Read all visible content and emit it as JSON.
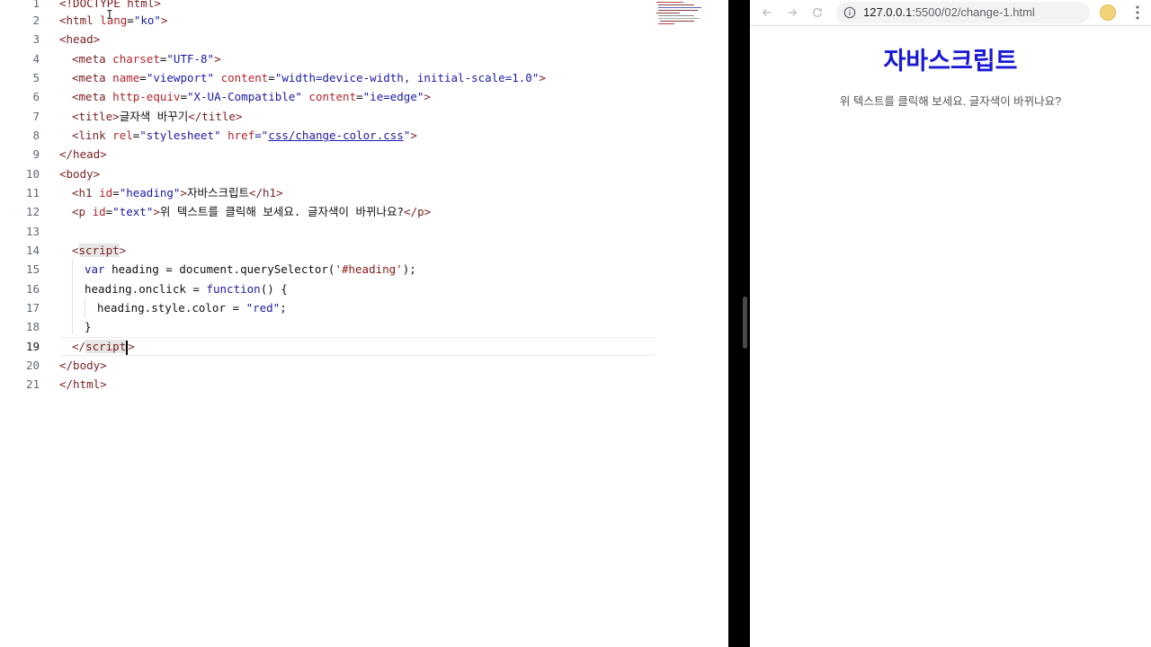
{
  "editor": {
    "active_line": 19,
    "line_numbers": [
      "1",
      "2",
      "3",
      "4",
      "5",
      "6",
      "7",
      "8",
      "9",
      "10",
      "11",
      "12",
      "13",
      "14",
      "15",
      "16",
      "17",
      "18",
      "19",
      "20",
      "21"
    ],
    "lines": {
      "l1": [
        "<!DOCTYPE html>"
      ],
      "l2": [
        "<html",
        " lang",
        "=",
        "\"ko\"",
        ">"
      ],
      "l3": [
        "<head>"
      ],
      "l4": [
        "<meta",
        " charset",
        "=",
        "\"UTF-8\"",
        ">"
      ],
      "l5": [
        "<meta",
        " name",
        "=",
        "\"viewport\"",
        " content",
        "=",
        "\"width=device-width, initial-scale=1.0\"",
        ">"
      ],
      "l6": [
        "<meta",
        " http-equiv",
        "=",
        "\"X-UA-Compatible\"",
        " content",
        "=",
        "\"ie=edge\"",
        ">"
      ],
      "l7": [
        "<title>",
        "글자색 바꾸기",
        "</title>"
      ],
      "l8": [
        "<link",
        " rel",
        "=",
        "\"stylesheet\"",
        " href",
        "=\"",
        "css/change-color.css",
        "\"",
        ">"
      ],
      "l9": [
        "</head>"
      ],
      "l10": [
        "<body>"
      ],
      "l11": [
        "<h1",
        " id",
        "=",
        "\"heading\"",
        ">",
        "자바스크립트",
        "</h1>"
      ],
      "l12": [
        "<p",
        " id",
        "=",
        "\"text\"",
        ">",
        "위 텍스트를 클릭해 보세요. 글자색이 바뀌나요?",
        "</p>"
      ],
      "l14": [
        "<",
        "script",
        ">"
      ],
      "l15": [
        "var",
        " heading = document.querySelector(",
        "'#heading'",
        ");"
      ],
      "l16": [
        "heading.onclick = ",
        "function",
        "() {"
      ],
      "l17": [
        "heading.style.color = ",
        "\"red\"",
        ";"
      ],
      "l18": [
        "}"
      ],
      "l19": [
        "</",
        "script",
        ">"
      ],
      "l20": [
        "</body>"
      ],
      "l21": [
        "</html>"
      ]
    }
  },
  "browser": {
    "url_host": "127.0.0.1",
    "url_path": ":5500/02/change-1.html",
    "page": {
      "heading": "자바스크립트",
      "paragraph": "위 텍스트를 클릭해 보세요. 글자색이 바뀌나요?"
    }
  },
  "colors": {
    "heading_blue": "#1a1ad6",
    "tag": "#7a1f1f",
    "attr": "#b4232a",
    "string": "#1a1aa6"
  },
  "icons": {
    "back": "back-arrow-icon",
    "forward": "forward-arrow-icon",
    "reload": "reload-icon",
    "info": "info-icon",
    "bookmark": "star-icon",
    "profile": "avatar",
    "menu": "kebab-menu-icon"
  }
}
